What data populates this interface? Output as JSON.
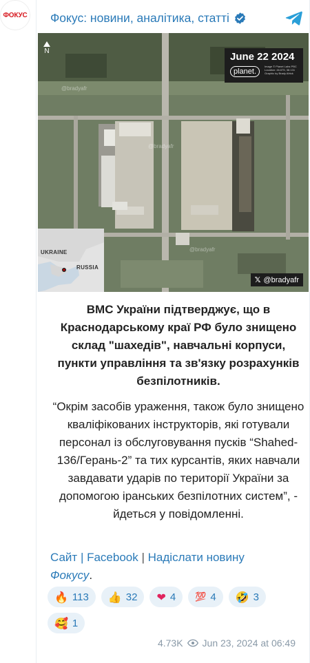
{
  "avatar": {
    "text": "ФОКУС",
    "color": "#d71920"
  },
  "header": {
    "channel_name": "Фокус: новини, аналітика, статті",
    "verified_icon": "verified-badge-icon",
    "share_icon": "telegram-share-icon",
    "accent": "#2a7ab8"
  },
  "photo": {
    "date": "June 22 2024",
    "brand": "planet.",
    "caption": "Image © Planet Labs PBC Location: 46.675, 38.131 Graphic by Brady Africk",
    "north": "N",
    "credit": "@bradyafr",
    "watermark": "@bradyafr",
    "inset_ukraine": "UKRAINE",
    "inset_russia": "RUSSIA"
  },
  "post": {
    "bold_text": "ВМС України підтверджує, що в Краснодарському краї РФ було знищено склад \"шахедів\", навчальні корпуси, пункти управління та зв'язку розрахунків безпілотників.",
    "quote_text": "“Окрім засобів ураження, також було знищено кваліфікованих інструкторів, які готували персонал із обслуговування пусків “Shahed-136/Герань-2” та тих курсантів, яких навчали завдавати ударів по території України за допомогою іранських безпілотних систем”, - йдеться у повідомленні."
  },
  "links": {
    "site": "Сайт",
    "sep1": " | ",
    "facebook": "Facebook",
    "sep2": " | ",
    "send_news": "Надіслати новину",
    "fokusu": "Фокусу",
    "period": "."
  },
  "reactions": [
    {
      "emoji": "🔥",
      "count": "113"
    },
    {
      "emoji": "👍",
      "count": "32"
    },
    {
      "emoji": "❤",
      "count": "4"
    },
    {
      "emoji": "💯",
      "count": "4"
    },
    {
      "emoji": "🤣",
      "count": "3"
    },
    {
      "emoji": "🥰",
      "count": "1"
    }
  ],
  "meta": {
    "views": "4.73K",
    "date": "Jun 23, 2024 at 06:49"
  }
}
